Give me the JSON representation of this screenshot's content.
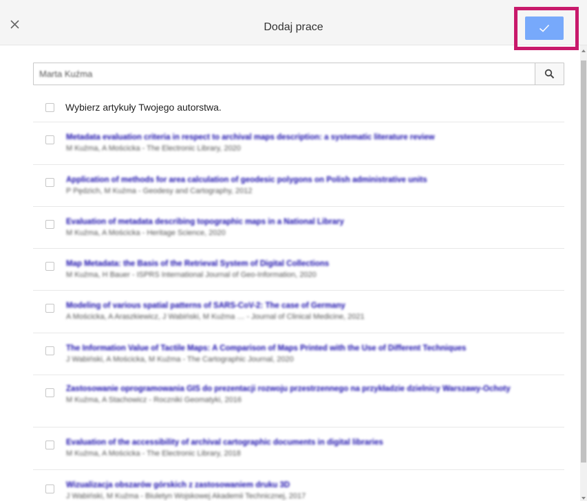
{
  "header": {
    "title": "Dodaj prace",
    "close_icon": "close-icon",
    "confirm_icon": "check-icon",
    "accent": "#4d90fe",
    "highlight": "#c8196b"
  },
  "search": {
    "value": "Marta Kuźma",
    "icon": "search-icon"
  },
  "select_all": {
    "label": "Wybierz artykuły Twojego autorstwa."
  },
  "articles": [
    {
      "title": "Metadata evaluation criteria in respect to archival maps description: a systematic literature review",
      "meta": "M Kuźma, A Mościcka - The Electronic Library, 2020"
    },
    {
      "title": "Application of methods for area calculation of geodesic polygons on Polish administrative units",
      "meta": "P Pędzich, M Kuźma - Geodesy and Cartography, 2012"
    },
    {
      "title": "Evaluation of metadata describing topographic maps in a National Library",
      "meta": "M Kuźma, A Mościcka - Heritage Science, 2020"
    },
    {
      "title": "Map Metadata: the Basis of the Retrieval System of Digital Collections",
      "meta": "M Kuźma, H Bauer - ISPRS International Journal of Geo-Information, 2020"
    },
    {
      "title": "Modeling of various spatial patterns of SARS-CoV-2: The case of Germany",
      "meta": "A Mościcka, A Araszkiewicz, J Wabiński, M Kuźma … - Journal of Clinical Medicine, 2021"
    },
    {
      "title": "The Information Value of Tactile Maps: A Comparison of Maps Printed with the Use of Different Techniques",
      "meta": "J Wabiński, A Mościcka, M Kuźma - The Cartographic Journal, 2020"
    },
    {
      "title": "Zastosowanie oprogramowania GIS do prezentacji rozwoju przestrzennego na przykładzie dzielnicy Warszawy-Ochoty",
      "meta": "M Kuźma, A Stachowicz - Roczniki Geomatyki, 2016"
    },
    {
      "title": "Evaluation of the accessibility of archival cartographic documents in digital libraries",
      "meta": "M Kuźma, A Mościcka - The Electronic Library, 2018"
    },
    {
      "title": "Wizualizacja obszarów górskich z zastosowaniem druku 3D",
      "meta": "J Wabiński, M Kuźma - Biuletyn Wojskowej Akademii Technicznej, 2017"
    }
  ]
}
